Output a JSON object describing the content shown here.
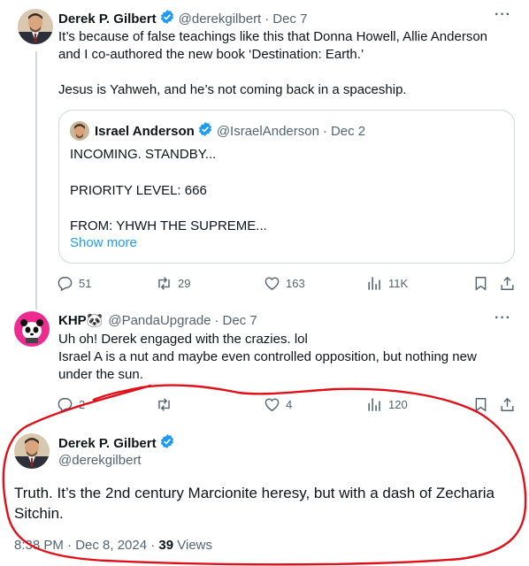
{
  "tweet1": {
    "author_name": "Derek P. Gilbert",
    "handle": "@derekgilbert",
    "date": "Dec 7",
    "text_line1": "It’s because of false teachings like this that Donna Howell, Allie Anderson",
    "text_line2": "and I co-authored the new book ‘Destination: Earth.’",
    "text_line3": "Jesus is Yahweh, and he’s not coming back in a spaceship.",
    "quote": {
      "author_name": "Israel Anderson",
      "handle": "@IsraelAnderson",
      "date": "Dec 2",
      "line1": "INCOMING. STANDBY...",
      "line2": "PRIORITY LEVEL: 666",
      "line3": "FROM: YHWH THE SUPREME...",
      "show_more": "Show more"
    },
    "actions": {
      "replies": "51",
      "reposts": "29",
      "likes": "163",
      "views": "11K"
    }
  },
  "tweet2": {
    "author_name": "KHP🐼",
    "handle": "@PandaUpgrade",
    "date": "Dec 7",
    "text_line1": "Uh oh! Derek engaged with the crazies. lol",
    "text_line2": "Israel A is a nut and maybe even controlled opposition, but nothing new",
    "text_line3": "under the sun.",
    "actions": {
      "replies": "2",
      "reposts": "",
      "likes": "4",
      "views": "120"
    }
  },
  "tweet3": {
    "author_name": "Derek P. Gilbert",
    "handle": "@derekgilbert",
    "text": "Truth. It’s the 2nd century Marcionite heresy, but with a dash of Zecharia Sitchin.",
    "timestamp": "8:38 PM · Dec 8, 2024 · ",
    "views_count": "39",
    "views_label": " Views"
  },
  "icons": {
    "more": "more-dots-icon",
    "verified": "verified-badge-icon",
    "reply": "reply-icon",
    "repost": "repost-icon",
    "like": "heart-icon",
    "views": "views-chart-icon",
    "bookmark": "bookmark-icon",
    "share": "share-icon"
  },
  "colors": {
    "accent": "#1d9bf0",
    "secondary_text": "#536471",
    "border": "#cfd9de",
    "annotation": "#e0101a"
  }
}
